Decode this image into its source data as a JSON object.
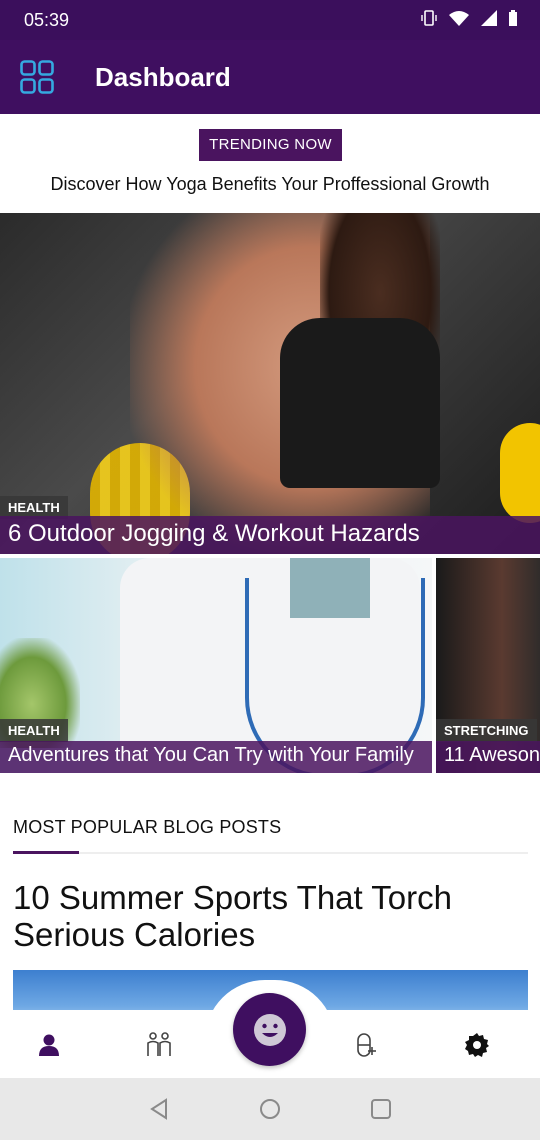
{
  "status_bar": {
    "time": "05:39"
  },
  "app_bar": {
    "title": "Dashboard",
    "menu_icon": "grid-icon"
  },
  "trending": {
    "button_label": "TRENDING NOW",
    "headline": "Discover How Yoga Benefits Your Proffessional Growth"
  },
  "featured": {
    "category": "HEALTH",
    "title": "6 Outdoor Jogging & Workout Hazards"
  },
  "carousel": [
    {
      "category": "HEALTH",
      "title": "Adventures that You Can Try with Your Family"
    },
    {
      "category": "STRETCHING",
      "title": "11 Aweson"
    }
  ],
  "popular": {
    "section_title": "MOST POPULAR BLOG POSTS",
    "post_title": "10 Summer Sports That Torch Serious Calories"
  },
  "bottom_nav": {
    "items": [
      "person-icon",
      "couple-icon",
      "smiley-icon",
      "pill-icon",
      "gear-icon"
    ]
  },
  "colors": {
    "brand": "#3f0f60",
    "accent": "#4a145f"
  }
}
